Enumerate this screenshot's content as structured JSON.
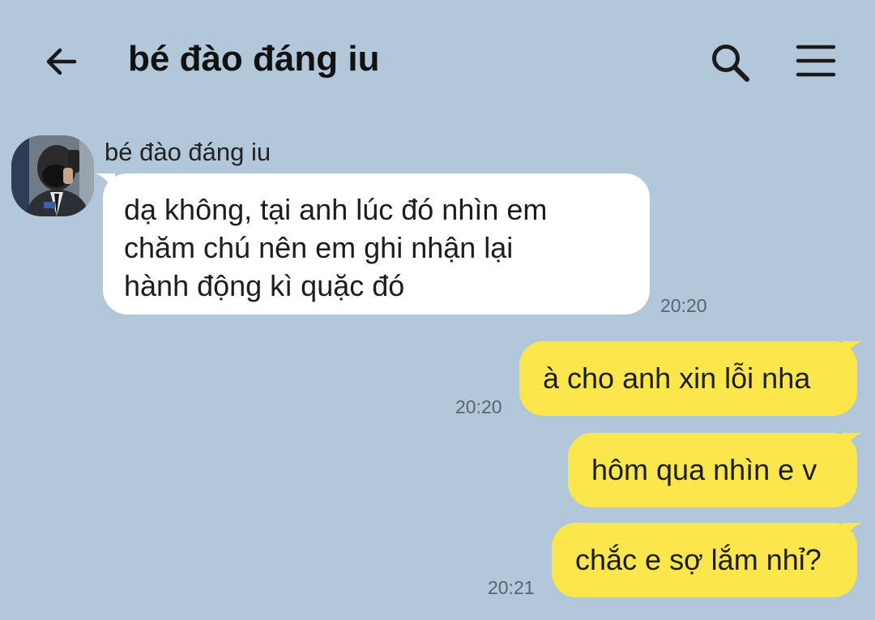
{
  "header": {
    "title": "bé đào đáng iu",
    "back_icon": "arrow-left-icon",
    "search_icon": "search-icon",
    "menu_icon": "hamburger-menu-icon"
  },
  "contact": {
    "name": "bé đào đáng iu"
  },
  "messages": [
    {
      "direction": "incoming",
      "lines": [
        "dạ không, tại anh lúc đó nhìn em",
        "chăm chú nên em ghi nhận lại",
        "hành động kì quặc đó"
      ],
      "time": "20:20"
    },
    {
      "direction": "outgoing",
      "text": "à cho anh xin lỗi nha",
      "time": "20:20"
    },
    {
      "direction": "outgoing",
      "text": "hôm qua nhìn e v",
      "time": ""
    },
    {
      "direction": "outgoing",
      "text": "chắc e sợ lắm nhỉ?",
      "time": "20:21"
    }
  ],
  "colors": {
    "background": "#b2c7da",
    "incoming_bubble": "#ffffff",
    "outgoing_bubble": "#fbe74b",
    "timestamp": "#59646f"
  }
}
